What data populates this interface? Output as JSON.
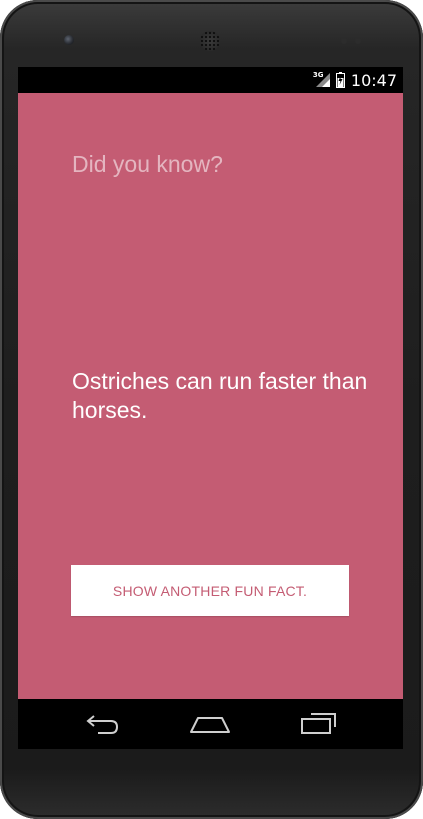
{
  "device": {
    "icons": [
      "camera-icon",
      "speaker-icon"
    ]
  },
  "status_bar": {
    "network_type": "3G",
    "time": "10:47",
    "icons": [
      "signal-icon",
      "battery-icon"
    ]
  },
  "app": {
    "heading": "Did you know?",
    "fact": "Ostriches can run faster than horses.",
    "button_label": "SHOW ANOTHER FUN FACT.",
    "colors": {
      "background": "#c45c73",
      "button_background": "#ffffff",
      "button_text": "#c45c73",
      "fact_text": "#ffffff"
    }
  },
  "nav_bar": {
    "icons": [
      "back-icon",
      "home-icon",
      "recent-apps-icon"
    ]
  }
}
